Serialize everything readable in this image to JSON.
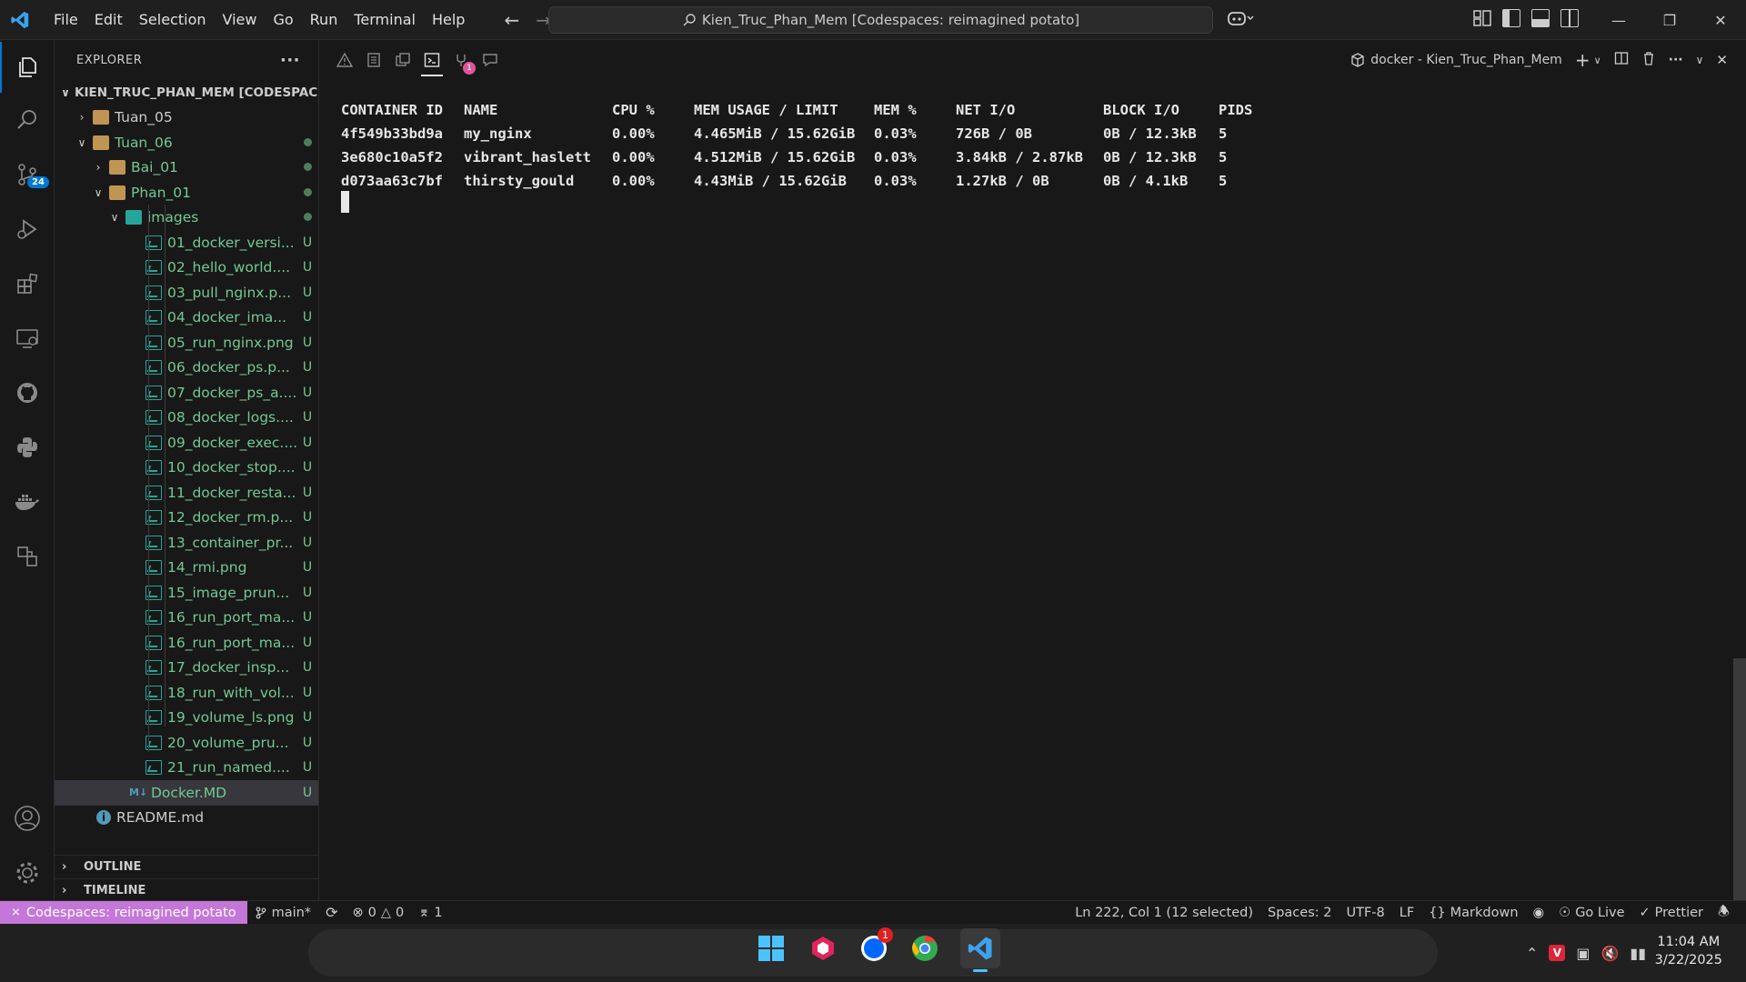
{
  "titlebar": {
    "menu": [
      "File",
      "Edit",
      "Selection",
      "View",
      "Go",
      "Run",
      "Terminal",
      "Help"
    ],
    "command_center": "Kien_Truc_Phan_Mem [Codespaces: reimagined potato]"
  },
  "activity": {
    "scm_badge": "24"
  },
  "explorer": {
    "title": "EXPLORER",
    "more": "···",
    "root": "KIEN_TRUC_PHAN_MEM [CODESPACES...",
    "items": [
      {
        "label": "Tuan_05"
      },
      {
        "label": "Tuan_06"
      },
      {
        "label": "Bai_01"
      },
      {
        "label": "Phan_01"
      },
      {
        "label": "images"
      },
      {
        "label": "01_docker_versi...",
        "status": "U"
      },
      {
        "label": "02_hello_world....",
        "status": "U"
      },
      {
        "label": "03_pull_nginx.p...",
        "status": "U"
      },
      {
        "label": "04_docker_ima...",
        "status": "U"
      },
      {
        "label": "05_run_nginx.png",
        "status": "U"
      },
      {
        "label": "06_docker_ps.p...",
        "status": "U"
      },
      {
        "label": "07_docker_ps_a....",
        "status": "U"
      },
      {
        "label": "08_docker_logs....",
        "status": "U"
      },
      {
        "label": "09_docker_exec....",
        "status": "U"
      },
      {
        "label": "10_docker_stop....",
        "status": "U"
      },
      {
        "label": "11_docker_resta...",
        "status": "U"
      },
      {
        "label": "12_docker_rm.p...",
        "status": "U"
      },
      {
        "label": "13_container_pr...",
        "status": "U"
      },
      {
        "label": "14_rmi.png",
        "status": "U"
      },
      {
        "label": "15_image_prun...",
        "status": "U"
      },
      {
        "label": "16_run_port_ma...",
        "status": "U"
      },
      {
        "label": "16_run_port_ma...",
        "status": "U"
      },
      {
        "label": "17_docker_insp...",
        "status": "U"
      },
      {
        "label": "18_run_with_vol...",
        "status": "U"
      },
      {
        "label": "19_volume_ls.png",
        "status": "U"
      },
      {
        "label": "20_volume_pru...",
        "status": "U"
      },
      {
        "label": "21_run_named....",
        "status": "U"
      },
      {
        "label": "Docker.MD",
        "status": "U"
      },
      {
        "label": "README.md"
      }
    ],
    "outline": "OUTLINE",
    "timeline": "TIMELINE"
  },
  "panel": {
    "ports_badge": "1",
    "terminal_name": "docker - Kien_Truc_Phan_Mem"
  },
  "terminal": {
    "headers": [
      "CONTAINER ID",
      "NAME",
      "CPU %",
      "MEM USAGE / LIMIT",
      "MEM %",
      "NET I/O",
      "BLOCK I/O",
      "PIDS"
    ],
    "rows": [
      [
        "4f549b33bd9a",
        "my_nginx",
        "0.00%",
        "4.465MiB / 15.62GiB",
        "0.03%",
        "726B / 0B",
        "0B / 12.3kB",
        "5"
      ],
      [
        "3e680c10a5f2",
        "vibrant_haslett",
        "0.00%",
        "4.512MiB / 15.62GiB",
        "0.03%",
        "3.84kB / 2.87kB",
        "0B / 12.3kB",
        "5"
      ],
      [
        "d073aa63c7bf",
        "thirsty_gould",
        "0.00%",
        "4.43MiB / 15.62GiB",
        "0.03%",
        "1.27kB / 0B",
        "0B / 4.1kB",
        "5"
      ]
    ]
  },
  "statusbar": {
    "remote": "Codespaces: reimagined potato",
    "branch": "main*",
    "errors": "0",
    "warnings": "0",
    "ports": "1",
    "position": "Ln 222, Col 1 (12 selected)",
    "spaces": "Spaces: 2",
    "encoding": "UTF-8",
    "eol": "LF",
    "language": "Markdown",
    "golive": "Go Live",
    "prettier": "Prettier"
  },
  "taskbar": {
    "zalo_badge": "1",
    "time": "11:04 AM",
    "date": "3/22/2025"
  }
}
